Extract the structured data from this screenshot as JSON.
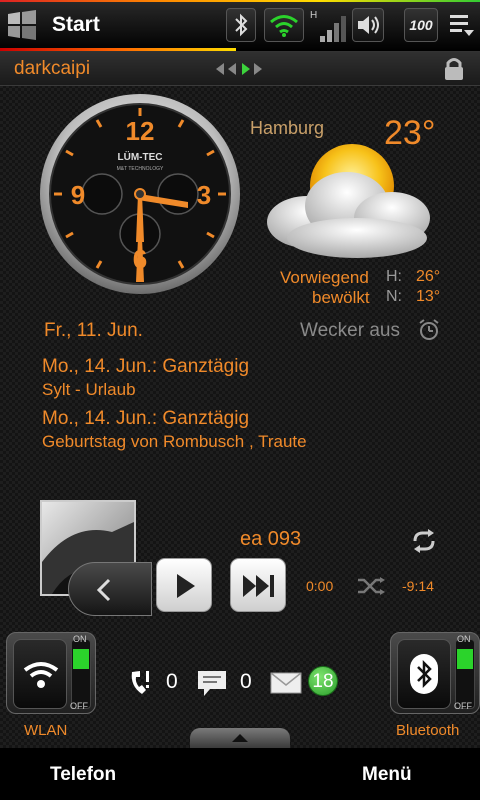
{
  "status_bar": {
    "title": "Start",
    "battery_level": "100"
  },
  "header": {
    "username": "darkcaipi"
  },
  "clock": {
    "brand": "LÜM-TEC",
    "subtitle": "M&T TECHNOLOGY",
    "numerals": [
      "12",
      "9",
      "3",
      "6"
    ]
  },
  "weather": {
    "city": "Hamburg",
    "temperature": "23°",
    "condition_line1": "Vorwiegend",
    "condition_line2": "bewölkt",
    "high_label": "H:",
    "high_value": "26°",
    "low_label": "N:",
    "low_value": "13°"
  },
  "today": {
    "date": "Fr., 11. Jun.",
    "alarm": "Wecker aus"
  },
  "events": [
    {
      "title": "Mo., 14. Jun.: Ganztägig",
      "subtitle": "Sylt - Urlaub"
    },
    {
      "title": "Mo., 14. Jun.: Ganztägig",
      "subtitle": "Geburtstag von Rombusch , Traute"
    }
  ],
  "player": {
    "track": "ea 093",
    "time_elapsed": "0:00",
    "time_remaining": "-9:14"
  },
  "toggles": {
    "wlan_label": "WLAN",
    "bluetooth_label": "Bluetooth",
    "on_label": "ON",
    "off_label": "OFF"
  },
  "notifications": {
    "missed_calls": "0",
    "sms": "0",
    "email": "18"
  },
  "softkeys": {
    "left": "Telefon",
    "right": "Menü"
  },
  "colors": {
    "accent": "#f08a2a",
    "toggle_on": "#2bd32b"
  }
}
